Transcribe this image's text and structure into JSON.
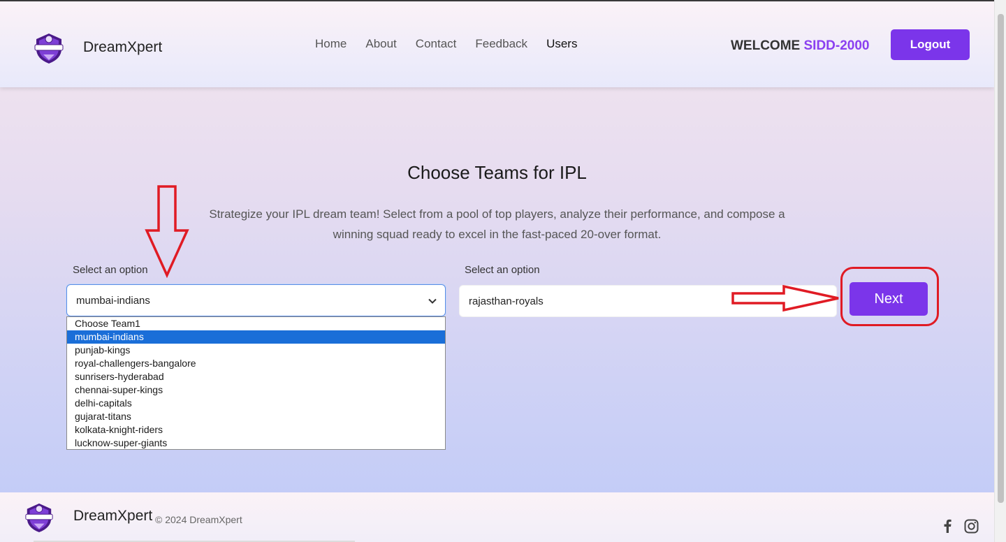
{
  "header": {
    "brand": "DreamXpert",
    "nav": [
      "Home",
      "About",
      "Contact",
      "Feedback",
      "Users"
    ],
    "welcome_prefix": "WELCOME",
    "username": "SIDD-2000",
    "logout_label": "Logout"
  },
  "main": {
    "title": "Choose Teams for IPL",
    "description": "Strategize your IPL dream team! Select from a pool of top players, analyze their performance, and compose a winning squad ready to excel in the fast-paced 20-over format.",
    "select1": {
      "label": "Select an option",
      "value": "mumbai-indians",
      "options": [
        "Choose Team1",
        "mumbai-indians",
        "punjab-kings",
        "royal-challengers-bangalore",
        "sunrisers-hyderabad",
        "chennai-super-kings",
        "delhi-capitals",
        "gujarat-titans",
        "kolkata-knight-riders",
        "lucknow-super-giants"
      ],
      "highlighted_option": "mumbai-indians"
    },
    "select2": {
      "label": "Select an option",
      "value": "rajasthan-royals"
    },
    "next_label": "Next"
  },
  "footer": {
    "brand": "DreamXpert",
    "copyright": "© 2024 DreamXpert"
  },
  "colors": {
    "accent": "#7b35ea",
    "username": "#8a3ff0",
    "annotation": "#e01b24",
    "highlight": "#1a6ed8"
  },
  "icons": [
    "logo-shield-icon",
    "chevron-down-icon",
    "facebook-icon",
    "instagram-icon"
  ]
}
